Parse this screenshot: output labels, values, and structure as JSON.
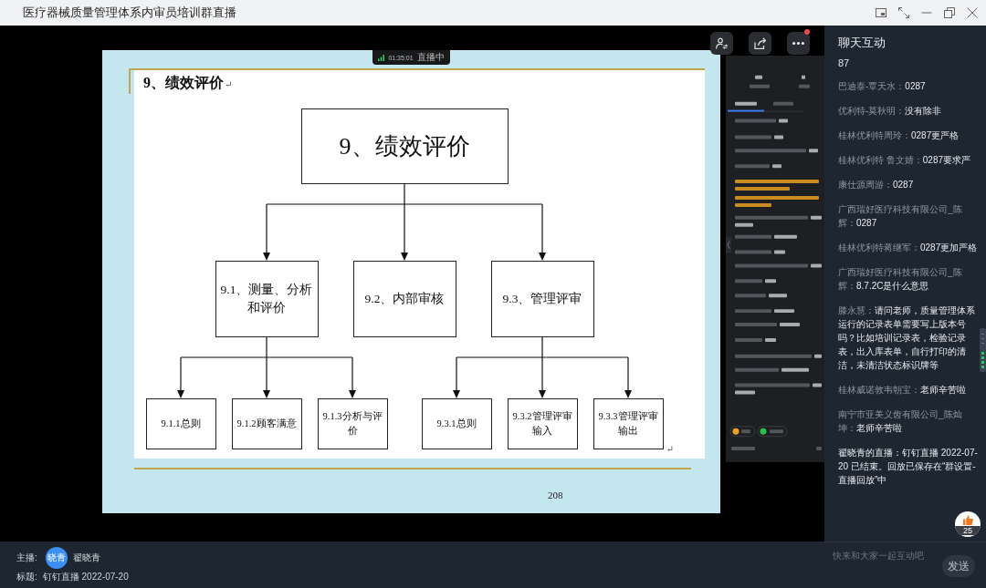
{
  "window": {
    "title": "医疗器械质量管理体系内审员培训群直播"
  },
  "stream": {
    "more_button": {
      "notification": true
    },
    "live_indicator": {
      "time": "01:35:01",
      "status": "直播中"
    },
    "slide": {
      "title": "9、绩效评价",
      "title_mark": "↵",
      "diagram": {
        "root": {
          "label": "9、绩效评价",
          "children": [
            {
              "label": "9.1、测量、分析和评价",
              "children": [
                {
                  "label": "9.1.1总则"
                },
                {
                  "label": "9.1.2顾客满意"
                },
                {
                  "label": "9.1.3分析与评价"
                }
              ]
            },
            {
              "label": "9.2、内部审核"
            },
            {
              "label": "9.3、管理评审",
              "children": [
                {
                  "label": "9.3.1总则"
                },
                {
                  "label": "9.3.2管理评审输入"
                },
                {
                  "label": "9.3.3管理评审输出"
                }
              ]
            }
          ]
        }
      },
      "end_mark": "↵",
      "page_number": "208"
    }
  },
  "chat": {
    "title": "聊天互动",
    "count": "87",
    "messages": [
      {
        "kind": "user",
        "name": "巴迪泰-覃天水：",
        "text": "0287"
      },
      {
        "kind": "user",
        "name": "优利特-莫秋明：",
        "text": "没有除非"
      },
      {
        "kind": "user",
        "name": "桂林优利特周玲：",
        "text": "0287更严格"
      },
      {
        "kind": "user",
        "name": "桂林优利特 鲁文婧：",
        "text": "0287要求严"
      },
      {
        "kind": "user",
        "name": "康仕源周游：",
        "text": "0287"
      },
      {
        "kind": "user",
        "name": "广西瑞好医疗科技有限公司_陈辉：",
        "text": "0287"
      },
      {
        "kind": "user",
        "name": "桂林优利特蒋继军：",
        "text": "0287更加严格"
      },
      {
        "kind": "user",
        "name": "广西瑞好医疗科技有限公司_陈辉：",
        "text": "8.7.2C是什么意思"
      },
      {
        "kind": "user",
        "name": "滕永慧：",
        "text": "请问老师，质量管理体系运行的记录表单需要写上版本号吗？比如培训记录表，检验记录表，出入库表单，自行打印的清洁，未清洁状态标识牌等"
      },
      {
        "kind": "user",
        "name": "桂林威诺敦韦朝宝：",
        "text": "老师辛苦啦"
      },
      {
        "kind": "user",
        "name": "南宁市亚美义齿有限公司_陈灿坤：",
        "text": "老师辛苦啦"
      },
      {
        "kind": "system",
        "name": "翟晓青的直播：",
        "text": "钉钉直播 2022-07-20 已结束。回放已保存在“群设置-直播回放”中"
      }
    ],
    "like_count": "25",
    "input": {
      "placeholder": "快来和大家一起互动吧"
    },
    "send_button": "发送"
  },
  "footer": {
    "host_label": "主播:",
    "host_avatar": "晓青",
    "host_name": "翟晓青",
    "title_label": "标题:",
    "title": "钉钉直播 2022-07-20"
  }
}
